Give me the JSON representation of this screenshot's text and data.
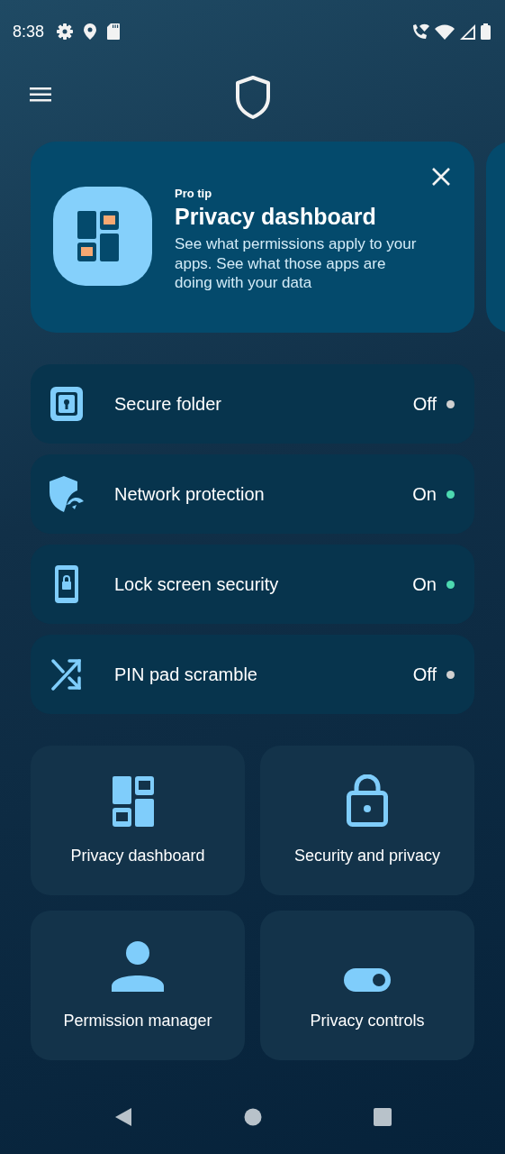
{
  "status_bar": {
    "time": "8:38"
  },
  "tip": {
    "eyebrow": "Pro tip",
    "title": "Privacy dashboard",
    "body": "See what permissions apply to your apps. See what those apps are doing with your data"
  },
  "features": [
    {
      "label": "Secure folder",
      "status": "Off",
      "on": false
    },
    {
      "label": "Network protection",
      "status": "On",
      "on": true
    },
    {
      "label": "Lock screen security",
      "status": "On",
      "on": true
    },
    {
      "label": "PIN pad scramble",
      "status": "Off",
      "on": false
    }
  ],
  "tiles": [
    {
      "label": "Privacy dashboard"
    },
    {
      "label": "Security and privacy"
    },
    {
      "label": "Permission manager"
    },
    {
      "label": "Privacy controls"
    }
  ]
}
